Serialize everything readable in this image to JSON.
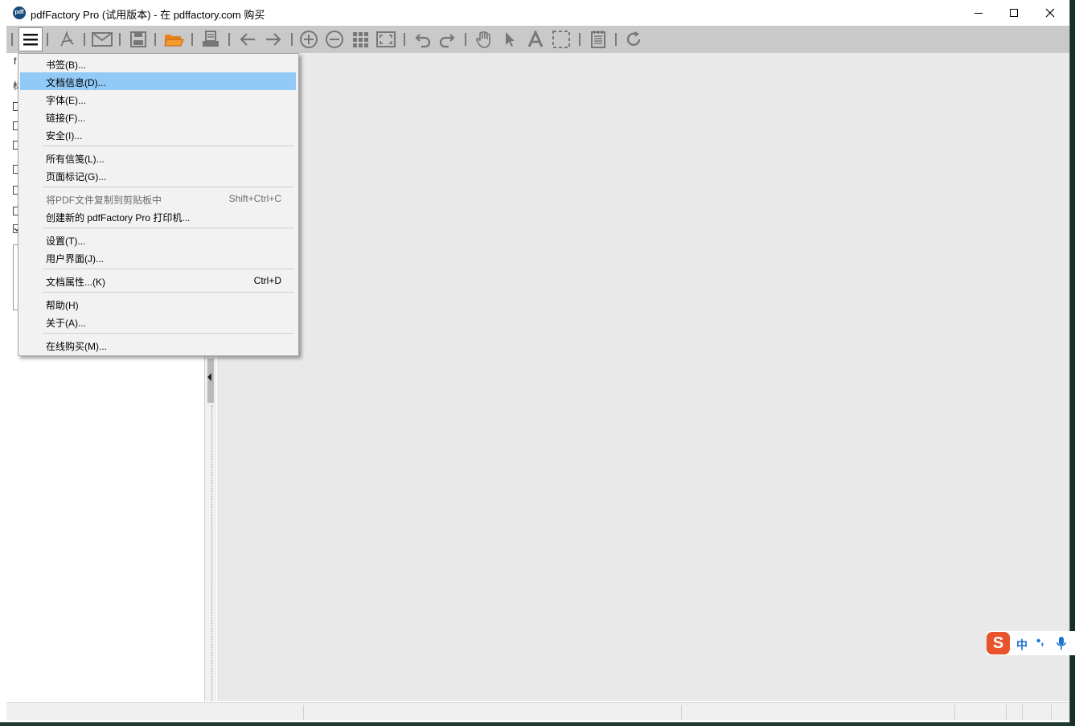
{
  "window": {
    "title": "pdfFactory Pro (试用版本) - 在 pdffactory.com 购买",
    "app_icon_text": "pdf"
  },
  "toolbar": {
    "icons": [
      "menu-icon",
      "pdf-icon",
      "email-icon",
      "save-icon",
      "open-folder-icon",
      "print-icon",
      "back-icon",
      "forward-icon",
      "zoom-in-icon",
      "zoom-out-icon",
      "grid-icon",
      "fit-page-icon",
      "undo-icon",
      "redo-icon",
      "hand-icon",
      "pointer-icon",
      "text-icon",
      "select-icon",
      "notes-icon",
      "refresh-icon"
    ]
  },
  "left_panel": {
    "frag_top": "f",
    "frag_second": "标"
  },
  "menu": {
    "items": [
      {
        "label": "书签(B)...",
        "shortcut": ""
      },
      {
        "label": "文档信息(D)...",
        "shortcut": ""
      },
      {
        "label": "字体(E)...",
        "shortcut": ""
      },
      {
        "label": "链接(F)...",
        "shortcut": ""
      },
      {
        "label": "安全(I)...",
        "shortcut": ""
      },
      {
        "label": "所有信笺(L)...",
        "shortcut": ""
      },
      {
        "label": "页面标记(G)...",
        "shortcut": ""
      },
      {
        "label": "将PDF文件复制到剪贴板中",
        "shortcut": "Shift+Ctrl+C"
      },
      {
        "label": "创建新的 pdfFactory Pro 打印机...",
        "shortcut": ""
      },
      {
        "label": "设置(T)...",
        "shortcut": ""
      },
      {
        "label": "用户界面(J)...",
        "shortcut": ""
      },
      {
        "label": "文档属性...(K)",
        "shortcut": "Ctrl+D"
      },
      {
        "label": "帮助(H)",
        "shortcut": ""
      },
      {
        "label": "关于(A)...",
        "shortcut": ""
      },
      {
        "label": "在线购买(M)...",
        "shortcut": ""
      }
    ]
  },
  "ime": {
    "logo": "S",
    "mode": "中",
    "punct": "•,"
  },
  "colors": {
    "toolbar_bg": "#c9c9c9",
    "menu_highlight": "#91c9f7",
    "canvas_bg": "#e9e9e9",
    "folder_orange": "#e8821c",
    "ime_brand": "#e8532b"
  }
}
